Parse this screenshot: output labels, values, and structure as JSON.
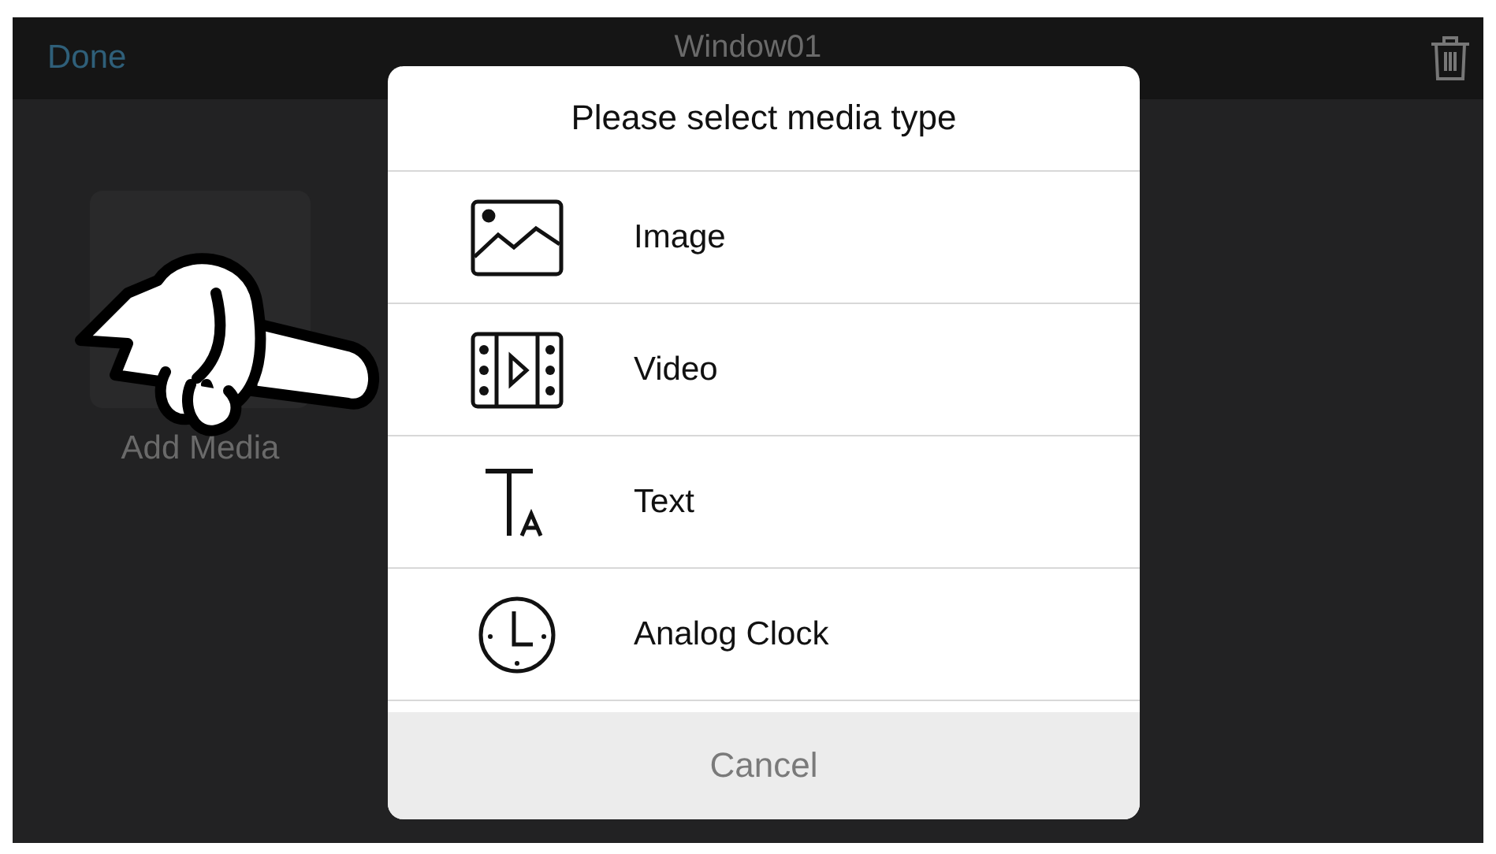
{
  "top_bar": {
    "done": "Done",
    "title": "Window01"
  },
  "tile": {
    "label": "Add Media"
  },
  "dialog": {
    "title": "Please select media type",
    "options": [
      {
        "kind": "image",
        "label": "Image"
      },
      {
        "kind": "video",
        "label": "Video"
      },
      {
        "kind": "text",
        "label": "Text"
      },
      {
        "kind": "clock",
        "label": "Analog Clock"
      }
    ],
    "cancel": "Cancel"
  }
}
